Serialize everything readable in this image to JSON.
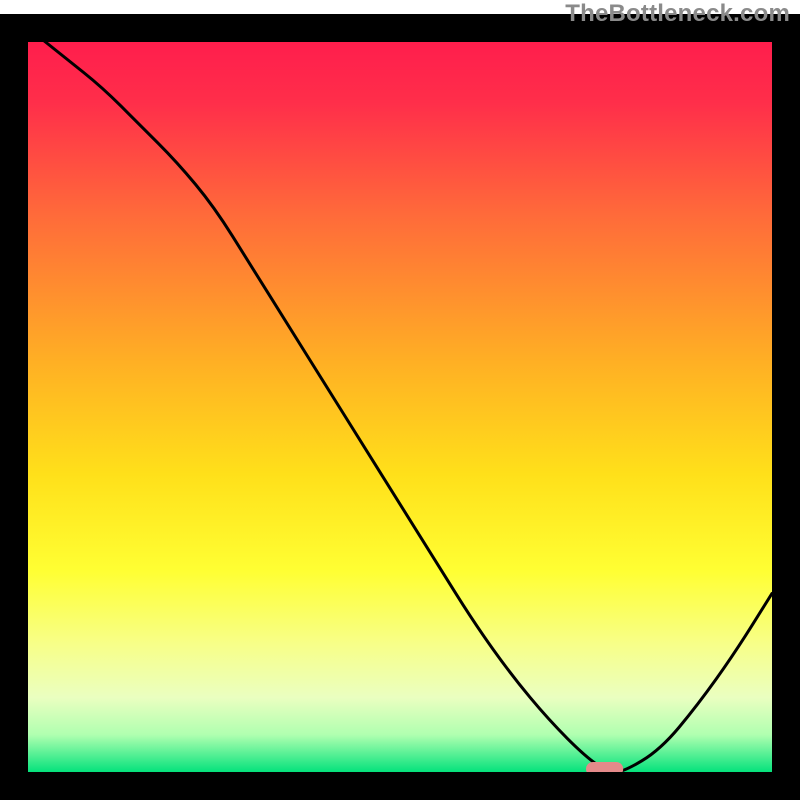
{
  "watermark": "TheBottleneck.com",
  "chart_data": {
    "type": "line",
    "title": "",
    "xlabel": "",
    "ylabel": "",
    "xlim": [
      0,
      100
    ],
    "ylim": [
      0,
      100
    ],
    "series": [
      {
        "name": "bottleneck-curve",
        "x": [
          0,
          5,
          10,
          15,
          20,
          25,
          30,
          35,
          40,
          45,
          50,
          55,
          60,
          65,
          70,
          75,
          78,
          80,
          85,
          90,
          95,
          100
        ],
        "values": [
          100,
          96,
          92,
          87,
          82,
          76,
          68,
          60,
          52,
          44,
          36,
          28,
          20,
          13,
          7,
          2,
          0,
          0,
          3,
          9,
          16,
          24
        ]
      }
    ],
    "marker": {
      "name": "optimal-range-marker",
      "x_start": 75,
      "x_end": 80,
      "y": 0,
      "color": "#e48a8a"
    },
    "background": {
      "type": "vertical-gradient",
      "stops": [
        {
          "pos": 0.0,
          "color": "#ff1a4d"
        },
        {
          "pos": 0.1,
          "color": "#ff2e4a"
        },
        {
          "pos": 0.25,
          "color": "#ff6a3a"
        },
        {
          "pos": 0.45,
          "color": "#ffb024"
        },
        {
          "pos": 0.6,
          "color": "#ffe01a"
        },
        {
          "pos": 0.73,
          "color": "#ffff33"
        },
        {
          "pos": 0.83,
          "color": "#f7ff8a"
        },
        {
          "pos": 0.9,
          "color": "#eaffc0"
        },
        {
          "pos": 0.95,
          "color": "#b0ffb0"
        },
        {
          "pos": 1.0,
          "color": "#05e27c"
        }
      ]
    },
    "frame_color": "#000000"
  }
}
